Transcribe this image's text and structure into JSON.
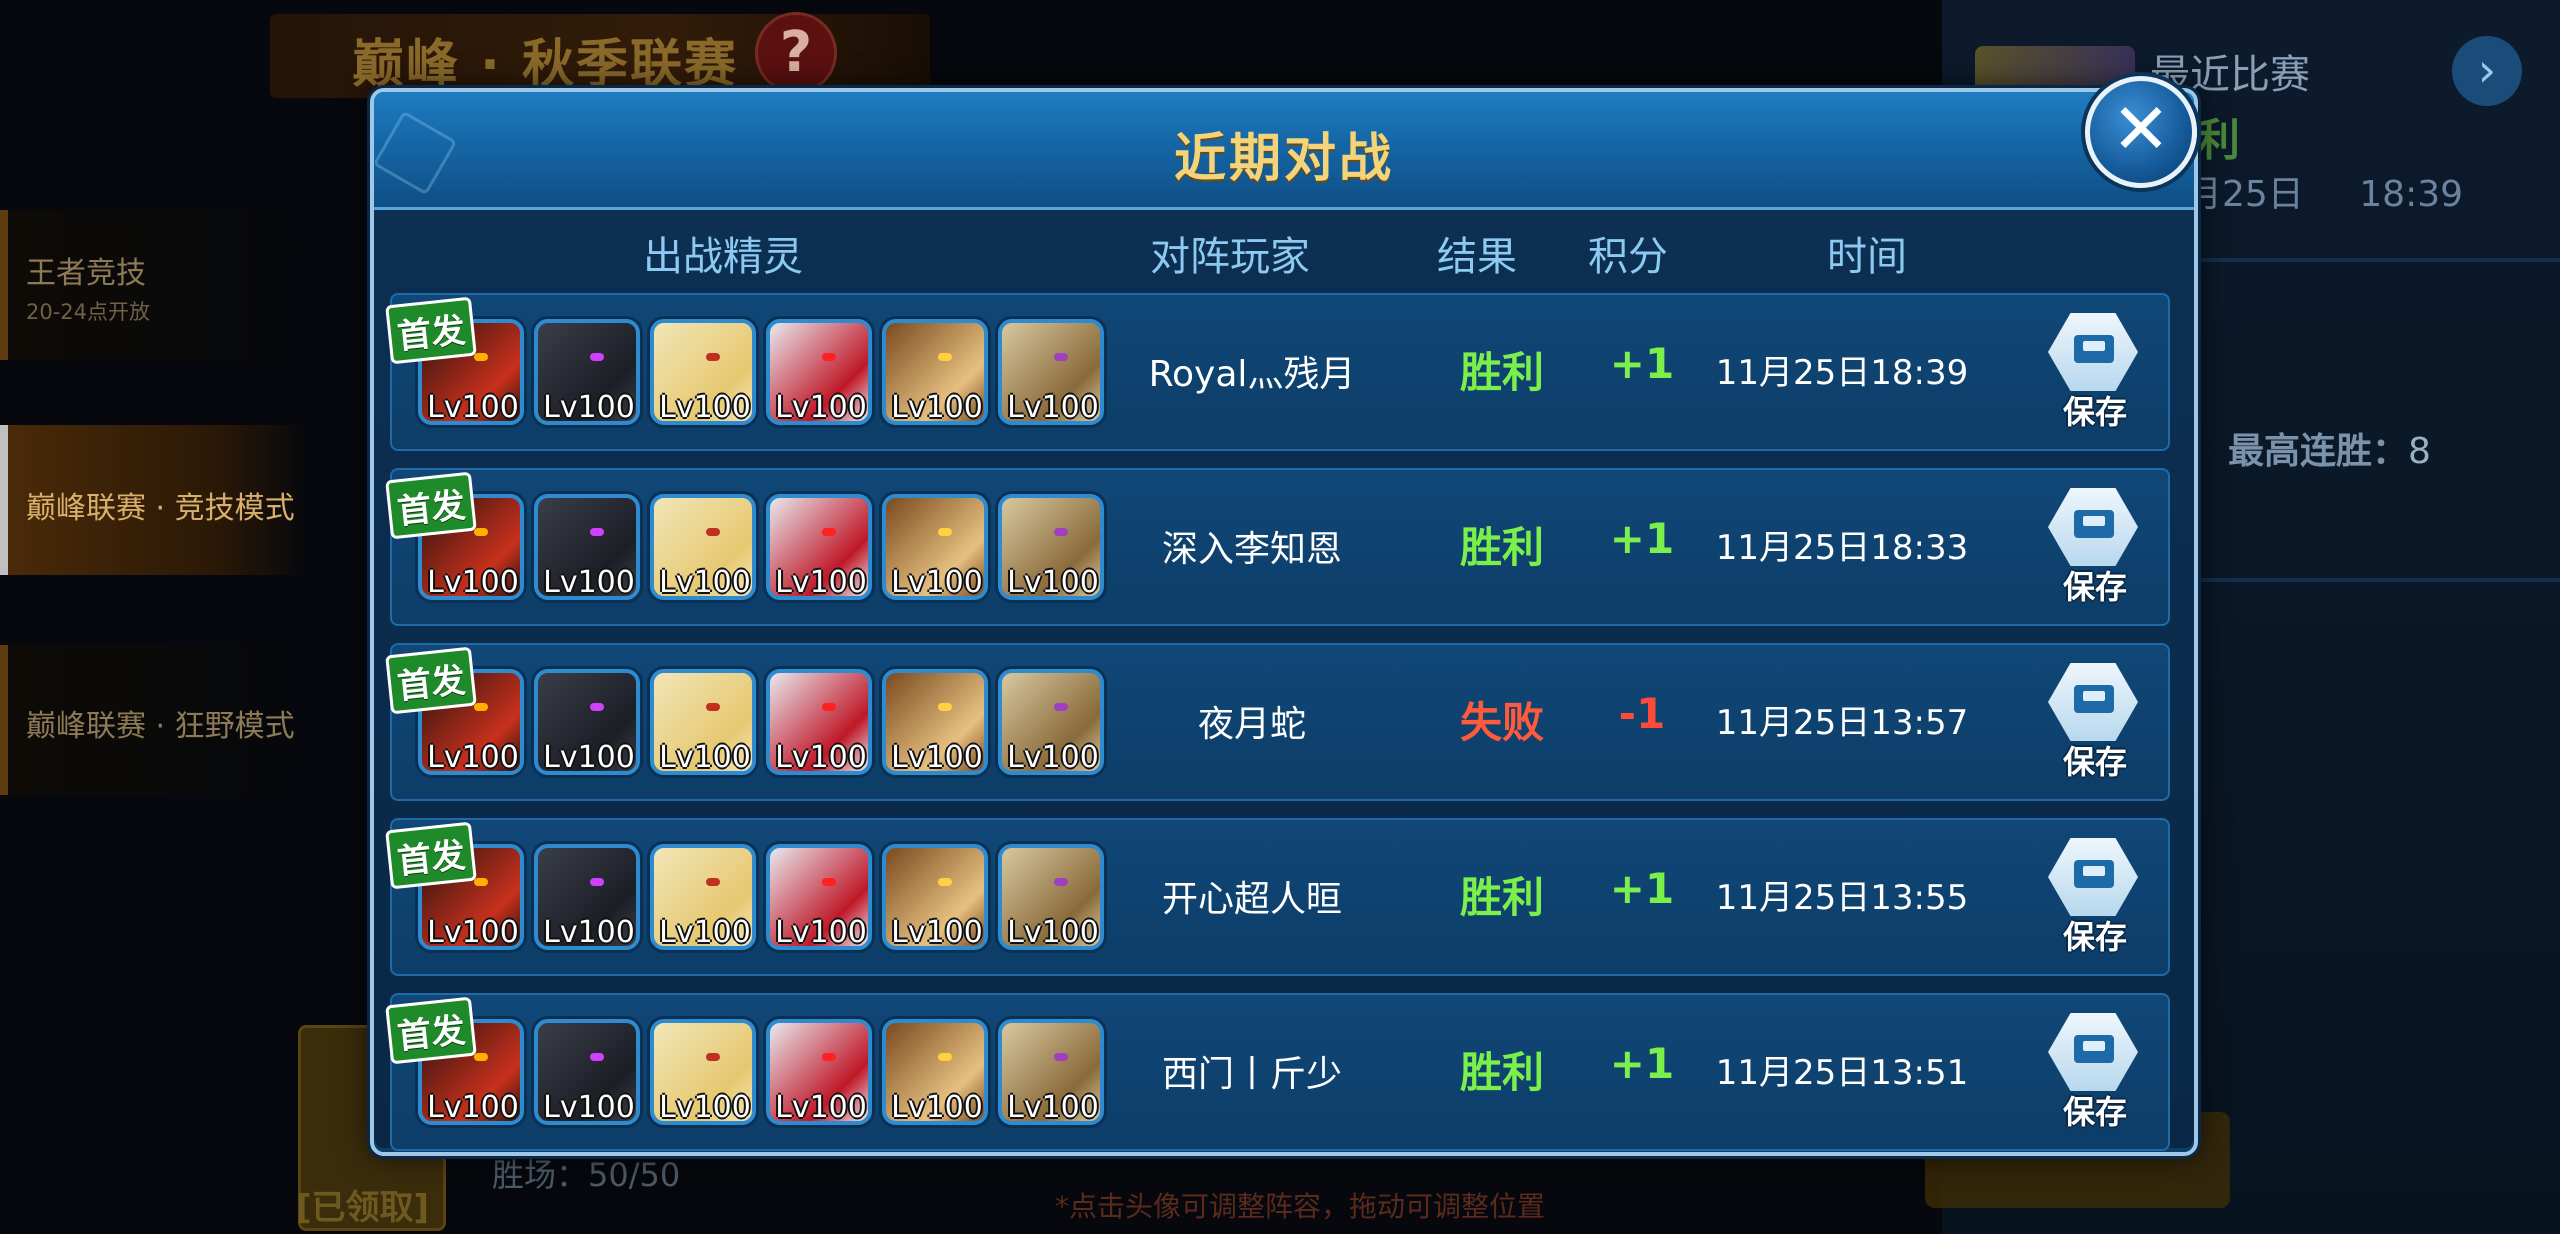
{
  "background": {
    "event_title": "巅峰 · 秋季联赛",
    "help_icon": "?",
    "left_menu": [
      {
        "label": "王者竞技",
        "sub": "20-24点开放"
      },
      {
        "label": "巅峰联赛 · 竞技模式",
        "sub": ""
      },
      {
        "label": "巅峰联赛 · 狂野模式",
        "sub": ""
      }
    ],
    "recent_match": {
      "title": "最近比赛",
      "result_partial": "利",
      "date": "月25日",
      "time": "18:39",
      "arrow_icon": "chevron-right-icon"
    },
    "max_streak": {
      "label": "最高连胜：",
      "value": "8"
    },
    "claimed_label": "[已领取]",
    "wins_label": "胜场：50/50",
    "hint": "*点击头像可调整阵容，拖动可调整位置"
  },
  "modal": {
    "title": "近期对战",
    "close_icon": "✕",
    "columns": {
      "sprites": "出战精灵",
      "opponent": "对阵玩家",
      "result": "结果",
      "score": "积分",
      "time": "时间"
    },
    "first_tag": "首发",
    "sprite_level": "Lv100",
    "save_label": "保存",
    "rows": [
      {
        "opponent": "Royal灬残月",
        "result": "胜利",
        "outcome": "win",
        "score": "+1",
        "time": "11月25日18:39"
      },
      {
        "opponent": "深入李知恩",
        "result": "胜利",
        "outcome": "win",
        "score": "+1",
        "time": "11月25日18:33"
      },
      {
        "opponent": "夜月蛇",
        "result": "失败",
        "outcome": "lose",
        "score": "-1",
        "time": "11月25日13:57"
      },
      {
        "opponent": "开心超人晅",
        "result": "胜利",
        "outcome": "win",
        "score": "+1",
        "time": "11月25日13:55"
      },
      {
        "opponent": "西门丨斤少",
        "result": "胜利",
        "outcome": "win",
        "score": "+1",
        "time": "11月25日13:51"
      }
    ],
    "sprites": [
      {
        "name": "dark-dragon-sprite",
        "bg": "#2a1410",
        "accent": "#c8301c",
        "eye": "#ffb000"
      },
      {
        "name": "shadow-wolf-sprite",
        "bg": "#3a3e48",
        "accent": "#1c1e26",
        "eye": "#d040ff"
      },
      {
        "name": "light-beast-sprite",
        "bg": "#f1e6b8",
        "accent": "#e6c870",
        "eye": "#c03020"
      },
      {
        "name": "white-knight-sprite",
        "bg": "#e8e8ee",
        "accent": "#c01828",
        "eye": "#ff2020"
      },
      {
        "name": "brown-falcon-sprite",
        "bg": "#7a4a20",
        "accent": "#e6c080",
        "eye": "#ffd040"
      },
      {
        "name": "golden-dragon-sprite",
        "bg": "#d8c8a0",
        "accent": "#8a6a3a",
        "eye": "#a040c0"
      }
    ]
  }
}
